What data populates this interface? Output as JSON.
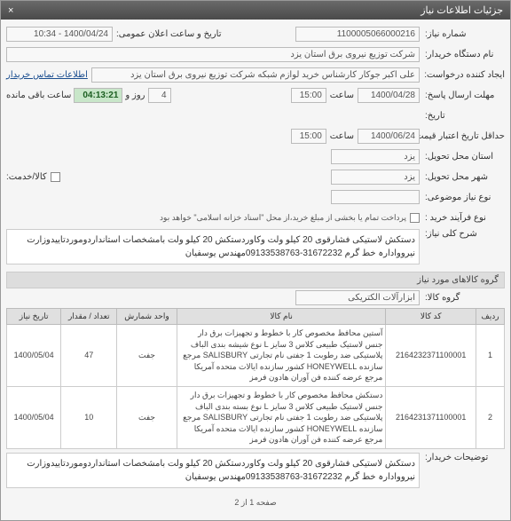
{
  "titlebar": {
    "title": "جزئیات اطلاعات نیاز",
    "close": "×"
  },
  "fields": {
    "need_no_label": "شماره نیاز:",
    "need_no": "1100005066000216",
    "pub_datetime_label": "تاریخ و ساعت اعلان عمومی:",
    "pub_datetime": "1400/04/24 - 10:34",
    "buyer_dev_label": "نام دستگاه خریدار:",
    "buyer_dev": "شرکت توزیع نیروی برق استان یزد",
    "req_creator_label": "ایجاد کننده درخواست:",
    "req_creator": "علی اکبر جوکار  کارشناس خرید لوازم شبکه  شرکت توزیع نیروی برق استان یزد",
    "contact_link": "اطلاعات تماس خریدار",
    "deadline_label": "مهلت ارسال پاسخ:",
    "deadline_date": "1400/04/28",
    "hour_lbl": "ساعت",
    "deadline_time": "15:00",
    "days_lbl": "4",
    "days_word": "روز و",
    "remaining_time": "04:13:21",
    "remaining_lbl": "ساعت باقی مانده",
    "to_date_lbl": "تاریخ:",
    "credit_hist_label": "حداقل تاریخ اعتبار قیمت تا تاریخ:",
    "credit_date": "1400/06/24",
    "credit_time": "15:00",
    "province_label": "استان محل تحویل:",
    "province": "یزد",
    "city_label": "شهر محل تحویل:",
    "city": "یزد",
    "item_svc_label": "کالا/خدمت:",
    "need_type_label": "نوع نیاز موضوعی:",
    "buy_process_label": "نوع فرآیند خرید :",
    "pay_note": "پرداخت تمام یا بخشی از مبلغ خرید،از محل \"اسناد خزانه اسلامی\" خواهد بود",
    "overall_desc_label": "شرح کلی نیاز:",
    "overall_desc": "دستکش لاستیکی فشارقوی 20 کیلو ولت وکاوردستکش 20 کیلو ولت بامشخصات استانداردوموردتاییدوزارت نیرووادارہ خط گرم 31672232-09133538763مهندس یوسفیان",
    "items_group_hdr": "گروه کالاهای مورد نیاز",
    "group_label": "گروه کالا:",
    "group_value": "ابزارآلات الکتریکی"
  },
  "table": {
    "headers": [
      "ردیف",
      "کد کالا",
      "نام کالا",
      "واحد شمارش",
      "تعداد / مقدار",
      "تاریخ نیاز"
    ],
    "rows": [
      {
        "idx": "1",
        "code": "2164232371100001",
        "name": "آستین محافظ مخصوص کار با خطوط و تجهیزات برق دار جنس لاستیک طبیعی کلاس 3 سایز L نوع شیشه بندی الباف پلاستیکی ضد رطوبت 1 جفتی نام تجارتی SALISBURY مرجع سازنده HONEYWELL کشور سازنده ایالات متحده آمریکا مرجع عرضه کننده فن آوران هادون فرمز",
        "unit": "جفت",
        "qty": "47",
        "date": "1400/05/04"
      },
      {
        "idx": "2",
        "code": "2164231371100001",
        "name": "دستکش محافظ مخصوص کار با خطوط و تجهیزات برق دار جنس لاستیک طبیعی کلاس 3 سایز L نوع بسته بندی الباف پلاستیکی ضد رطوبت 1 جفتی نام تجارتی SALISBURY مرجع سازنده HONEYWELL کشور سازنده ایالات متحده آمریکا مرجع عرضه کننده فن آوران هادون فرمز",
        "unit": "جفت",
        "qty": "10",
        "date": "1400/05/04"
      }
    ]
  },
  "buyer_notes": {
    "label": "توضیحات خریدار:",
    "text": "دستکش لاستیکی فشارقوی 20 کیلو ولت وکاوردستکش 20 کیلو ولت بامشخصات استانداردوموردتاییدوزارت نیرووادارہ خط گرم 31672232-09133538763مهندس یوسفیان"
  },
  "footer": {
    "page_lbl": "صفحه 1 از 2"
  }
}
